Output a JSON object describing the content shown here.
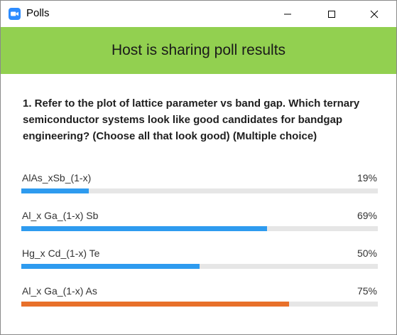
{
  "window": {
    "title": "Polls",
    "app_icon": "zoom-camera-icon",
    "controls": [
      "minimize-icon",
      "maximize-icon",
      "close-icon"
    ]
  },
  "banner": {
    "text": "Host is sharing poll results",
    "color": "#92d050"
  },
  "poll": {
    "question": "1. Refer to the plot of lattice parameter vs band gap.  Which ternary semiconductor systems look like good candidates for bandgap engineering?  (Choose all that look good) (Multiple choice)",
    "options": [
      {
        "label": "AlAs_xSb_(1-x)",
        "percent_text": "19%",
        "value": 19,
        "color": "#2e9bef"
      },
      {
        "label": "Al_x Ga_(1-x) Sb",
        "percent_text": "69%",
        "value": 69,
        "color": "#2e9bef"
      },
      {
        "label": "Hg_x Cd_(1-x) Te",
        "percent_text": "50%",
        "value": 50,
        "color": "#2e9bef"
      },
      {
        "label": "Al_x Ga_(1-x) As",
        "percent_text": "75%",
        "value": 75,
        "color": "#e8702a"
      }
    ]
  }
}
